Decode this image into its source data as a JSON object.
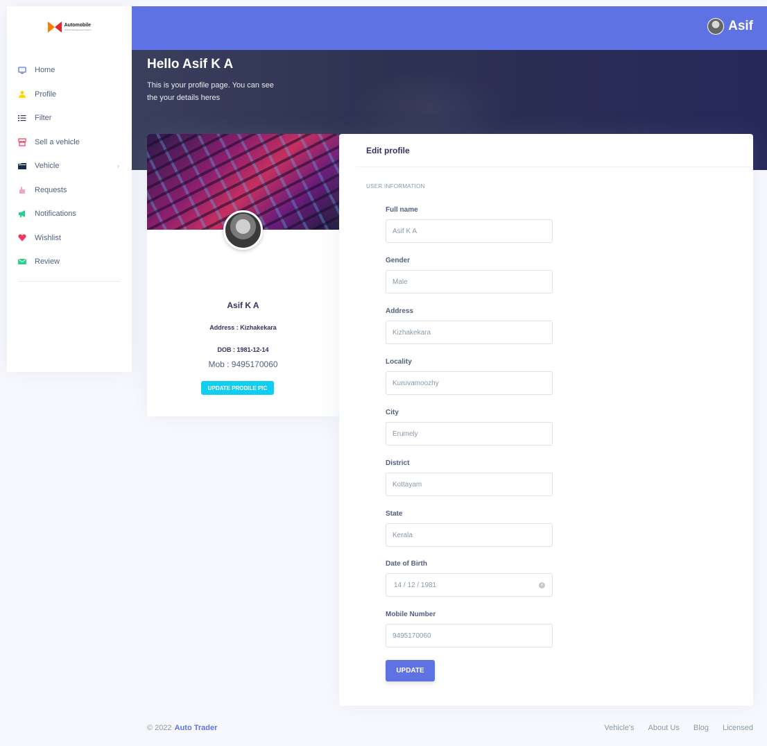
{
  "brand": {
    "name": "Automobile",
    "subtitle": "Vehicle Management System"
  },
  "sidebar": {
    "items": [
      {
        "label": "Home",
        "icon": "monitor-icon",
        "color": "#5e72e4"
      },
      {
        "label": "Profile",
        "icon": "user-icon",
        "color": "#ffd600"
      },
      {
        "label": "Filter",
        "icon": "list-icon",
        "color": "#32325d"
      },
      {
        "label": "Sell a vehicle",
        "icon": "shop-icon",
        "color": "#f5365c"
      },
      {
        "label": "Vehicle",
        "icon": "folder-icon",
        "color": "#172b4d"
      },
      {
        "label": "Requests",
        "icon": "thumbs-up-icon",
        "color": "#f3a4b5"
      },
      {
        "label": "Notifications",
        "icon": "megaphone-icon",
        "color": "#2dce89"
      },
      {
        "label": "Wishlist",
        "icon": "heart-icon",
        "color": "#f5365c"
      },
      {
        "label": "Review",
        "icon": "email-icon",
        "color": "#2dce89"
      }
    ]
  },
  "topbar": {
    "user_name": "Asif"
  },
  "hero": {
    "title": "Hello Asif K A",
    "text": "This is your profile page. You can see the your details heres"
  },
  "profile_card": {
    "name": "Asif K A",
    "address": "Address : Kizhakekara",
    "dob": "DOB : 1981-12-14",
    "mob": "Mob : 9495170060",
    "button": "UPDATE PRODILE PIC"
  },
  "edit": {
    "title": "Edit profile",
    "section": "USER INFORMATION",
    "fields": [
      {
        "label": "Full name",
        "value": "Asif K A"
      },
      {
        "label": "Gender",
        "value": "Male"
      },
      {
        "label": "Address",
        "value": "Kizhakekara"
      },
      {
        "label": "Locality",
        "value": "Kuruvamoozhy"
      },
      {
        "label": "City",
        "value": "Erumely"
      },
      {
        "label": "District",
        "value": "Kottayam"
      },
      {
        "label": "State",
        "value": "Kerala"
      },
      {
        "label": "Date of Birth",
        "value": "14 / 12 / 1981"
      },
      {
        "label": "Mobile Number",
        "value": "9495170060"
      }
    ],
    "button": "UPDATE"
  },
  "footer": {
    "copyright": "© 2022",
    "brand": "Auto Trader",
    "links": [
      "Vehicle's",
      "About Us",
      "Blog",
      "Licensed"
    ]
  }
}
